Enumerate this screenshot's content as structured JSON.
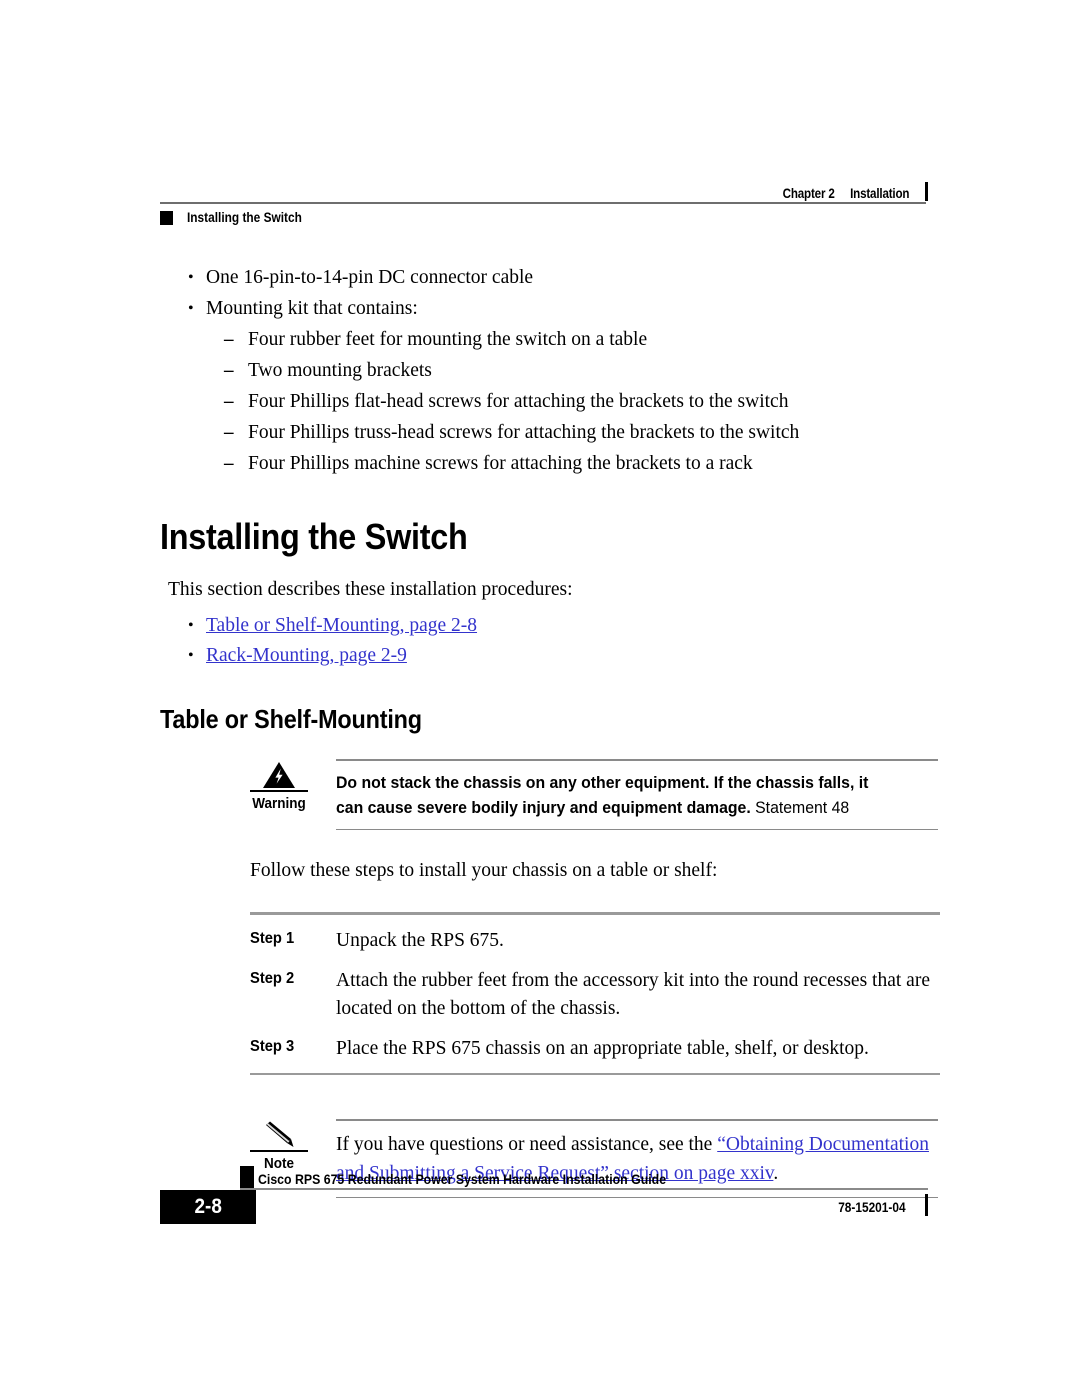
{
  "header": {
    "chapter": "Chapter 2",
    "chapter_section": "Installation",
    "running_section": "Installing the Switch"
  },
  "kit_list": {
    "bullets": [
      "One 16-pin-to-14-pin DC connector cable",
      "Mounting kit that contains:"
    ],
    "sub_items": [
      "Four rubber feet for mounting the switch on a table",
      "Two mounting brackets",
      "Four Phillips flat-head screws for attaching the brackets to the switch",
      "Four Phillips truss-head screws for attaching the brackets to the switch",
      "Four Phillips machine screws for attaching the brackets to a rack"
    ]
  },
  "section": {
    "h1": "Installing the Switch",
    "intro": "This section describes these installation procedures:",
    "xrefs": [
      "Table or Shelf-Mounting, page 2-8",
      "Rack-Mounting, page 2-9"
    ],
    "h2": "Table or Shelf-Mounting"
  },
  "warning": {
    "label": "Warning",
    "icon": "warning-triangle-lightning-icon",
    "text_bold": "Do not stack the chassis on any other equipment. If the chassis falls, it can cause severe bodily injury and equipment damage.",
    "statement": "Statement 48"
  },
  "procedure": {
    "intro": "Follow these steps to install your chassis on a table or shelf:",
    "steps": [
      {
        "label": "Step 1",
        "text": "Unpack the RPS 675."
      },
      {
        "label": "Step 2",
        "text": "Attach the rubber feet from the accessory kit into the round recesses that are located on the bottom of the chassis."
      },
      {
        "label": "Step 3",
        "text": "Place the RPS 675 chassis on an appropriate table, shelf, or desktop."
      }
    ]
  },
  "note": {
    "label": "Note",
    "icon": "pencil-icon",
    "text_before": "If you have questions or need assistance, see the ",
    "link_text": "“Obtaining Documentation and Submitting a Service Request” section on page xxiv",
    "text_after": "."
  },
  "footer": {
    "page_number": "2-8",
    "guide_title": "Cisco RPS 675 Redundant Power System Hardware Installation Guide",
    "doc_number": "78-15201-04"
  },
  "colors": {
    "link_blue": "#3333CC",
    "rule_gray": "#8A8A8A",
    "black": "#000000"
  }
}
